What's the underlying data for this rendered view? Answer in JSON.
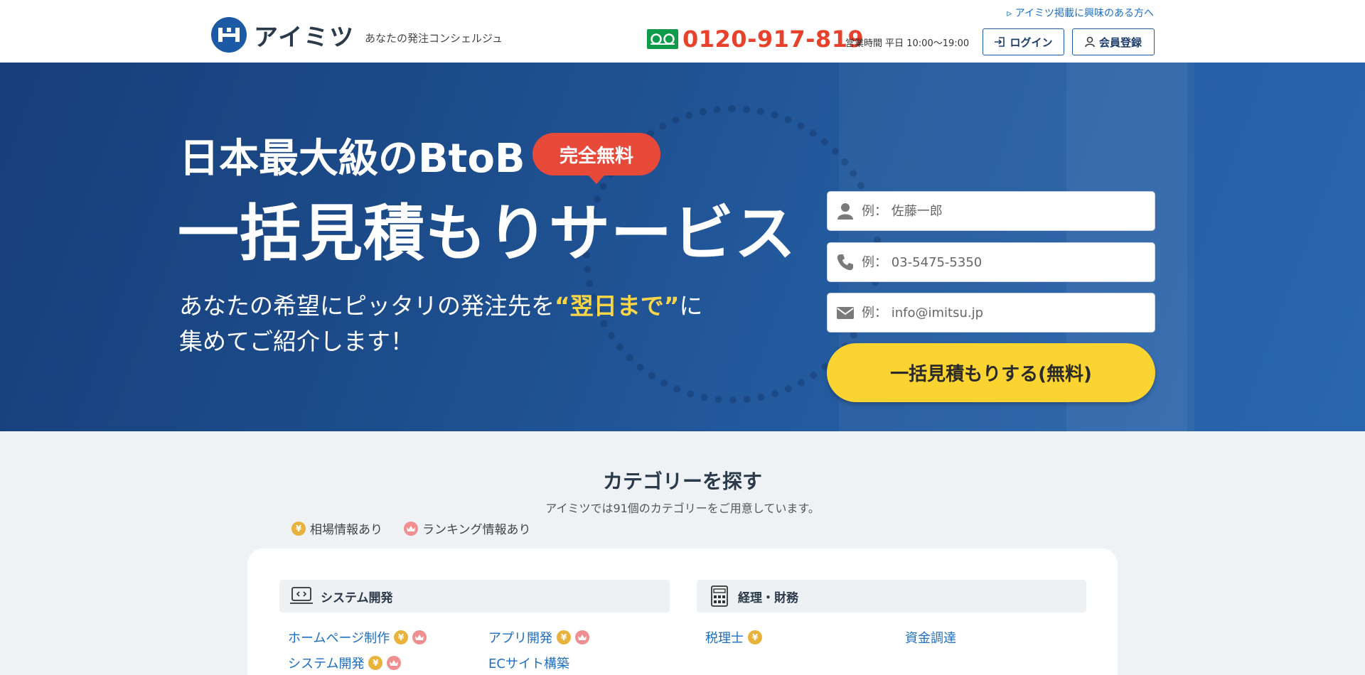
{
  "header": {
    "logo_text": "アイミツ",
    "tagline": "あなたの発注コンシェルジュ",
    "top_link": "アイミツ掲載に興味のある方へ",
    "phone": "0120-917-819",
    "hours": "営業時間 平日 10:00〜19:00",
    "login_label": "ログイン",
    "register_label": "会員登録"
  },
  "hero": {
    "title_line1": "日本最大級のBtoB",
    "badge": "完全無料",
    "title_line2": "一括見積もりサービス",
    "subtitle_pre": "あなたの希望にピッタリの発注先を",
    "subtitle_highlight": "“翌日まで”",
    "subtitle_post": "に",
    "subtitle_line2": "集めてご紹介します！",
    "form": {
      "name_placeholder": "例： 佐藤一郎",
      "phone_placeholder": "例： 03-5475-5350",
      "email_placeholder": "例： info@imitsu.jp",
      "submit_label": "一括見積もりする(無料)"
    }
  },
  "categories": {
    "title": "カテゴリーを探す",
    "subtitle": "アイミツでは91個のカテゴリーをご用意しています。",
    "legend_price": "相場情報あり",
    "legend_ranking": "ランキング情報あり",
    "yen_symbol": "¥",
    "groups": [
      {
        "title": "システム開発",
        "icon": "laptop-code-icon",
        "links": [
          "ホームページ制作",
          "アプリ開発",
          "システム開発",
          "ECサイト構築"
        ]
      },
      {
        "title": "経理・財務",
        "icon": "calculator-icon",
        "links": [
          "税理士",
          "資金調達"
        ]
      }
    ]
  },
  "colors": {
    "brand": "#1d5aa5",
    "phone": "#e8412c",
    "cta": "#fbd431",
    "badge": "#e84a3a",
    "highlight": "#f9d548",
    "link": "#1d6fc4"
  }
}
